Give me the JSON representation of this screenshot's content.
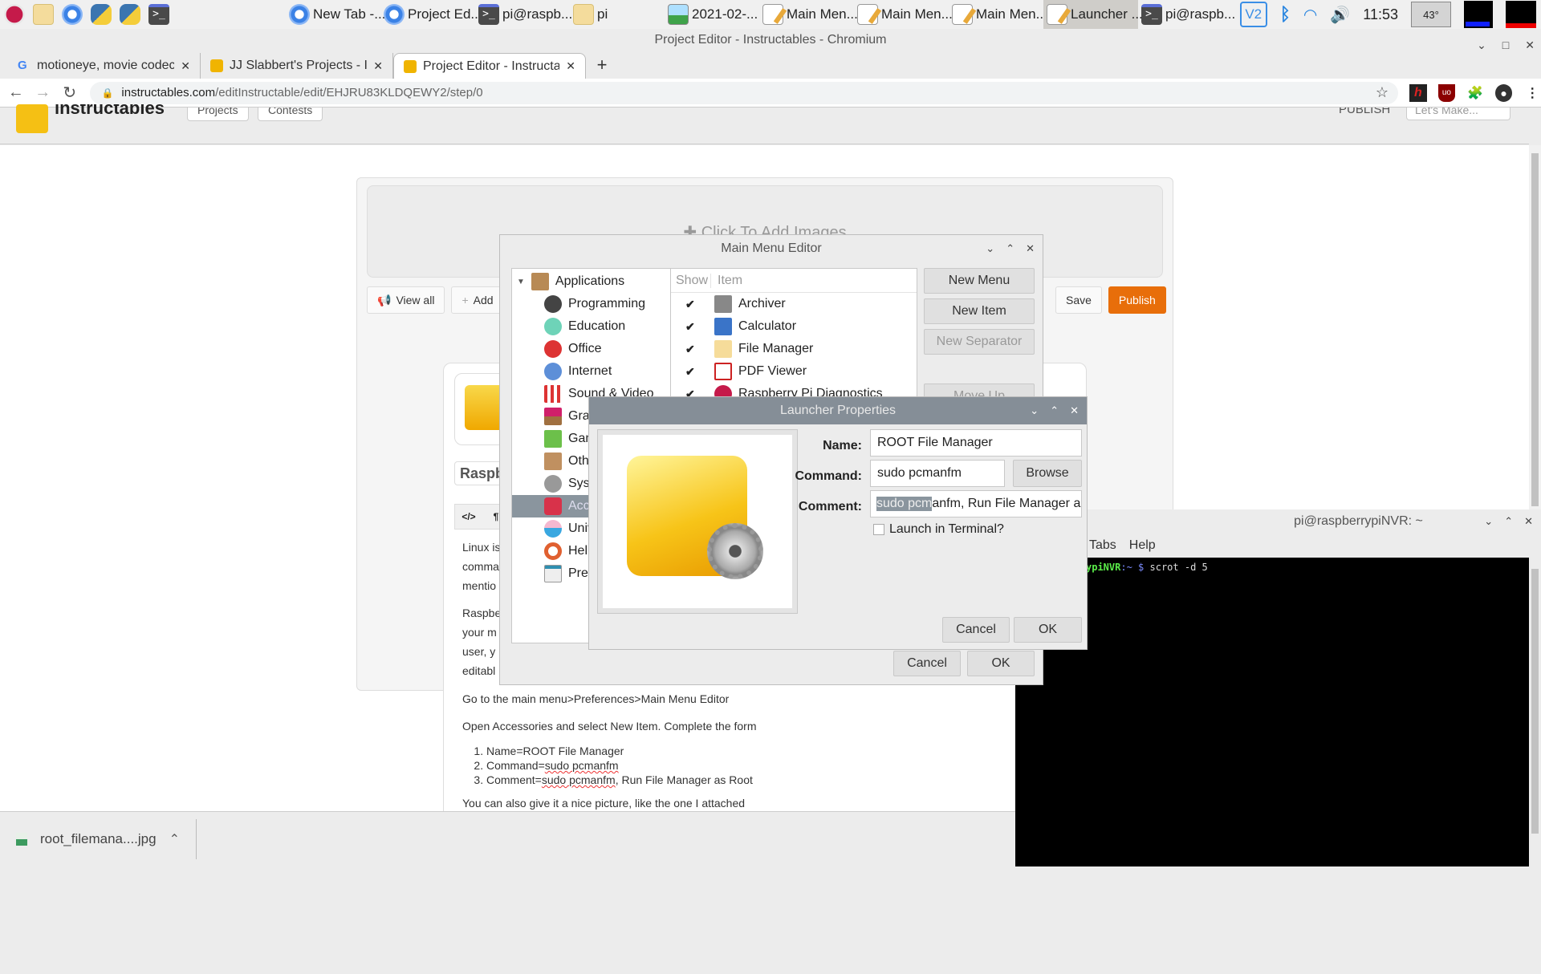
{
  "taskbar": {
    "launchers": [
      "raspberry-menu",
      "file-manager",
      "chromium",
      "python",
      "python",
      "terminal"
    ],
    "tasks": [
      {
        "label": "New Tab -...",
        "icon": "chromium"
      },
      {
        "label": "Project Ed...",
        "icon": "chromium"
      },
      {
        "label": "pi@raspb...",
        "icon": "terminal"
      },
      {
        "label": "pi",
        "icon": "folder"
      },
      {
        "label": "2021-02-...",
        "icon": "image"
      },
      {
        "label": "Main Men...",
        "icon": "menu-editor"
      },
      {
        "label": "Main Men...",
        "icon": "menu-editor"
      },
      {
        "label": "Main Men...",
        "icon": "menu-editor"
      },
      {
        "label": "Launcher ...",
        "icon": "menu-editor",
        "active": true
      },
      {
        "label": "pi@raspb...",
        "icon": "terminal"
      }
    ],
    "clock": "11:53",
    "temperature": "43°"
  },
  "browser": {
    "window_title": "Project Editor - Instructables - Chromium",
    "tabs": [
      {
        "title": "motioneye, movie codec",
        "favicon": "google"
      },
      {
        "title": "JJ Slabbert's Projects - I",
        "favicon": "instructables"
      },
      {
        "title": "Project Editor - Instructab",
        "favicon": "instructables",
        "active": true
      }
    ],
    "new_tab": "+",
    "url_host": "instructables.com",
    "url_path": "/editInstructable/edit/EHJRU83KLDQEWY2/step/0"
  },
  "site": {
    "logo": "instructables",
    "nav": [
      "Projects",
      "Contests"
    ],
    "publish_link": "PUBLISH",
    "search_placeholder": "Let's Make..."
  },
  "editor": {
    "add_images": "Click To Add Images",
    "toolbar": {
      "view_all": "View all",
      "add": "Add",
      "save": "Save",
      "publish": "Publish"
    },
    "step_title_partial": "Raspb",
    "format_buttons": [
      "</>",
      "¶"
    ],
    "paragraphs_partial": [
      "Linux is",
      "comma",
      "mentio",
      "Raspbe",
      "your m",
      "user, y",
      "editabl"
    ],
    "paragraph1": "Go to the main menu>Preferences>Main Menu Editor",
    "paragraph2": "Open Accessories and select New Item. Complete the form",
    "list": [
      {
        "prefix": "Name=ROOT File Manager",
        "sq": "",
        "rest": ""
      },
      {
        "prefix": "Command=",
        "sq": "sudo pcmanfm",
        "rest": ""
      },
      {
        "prefix": "Comment=",
        "sq": "sudo pcmanfm",
        "rest": ", Run File Manager as Root"
      }
    ],
    "paragraph3": "You can also give it a nice picture, like the one I attached"
  },
  "downloads": {
    "file": "root_filemana....jpg"
  },
  "main_menu_editor": {
    "title": "Main Menu Editor",
    "tree": [
      {
        "label": "Applications",
        "icon": "box",
        "root": true
      },
      {
        "label": "Programming",
        "icon": "programming"
      },
      {
        "label": "Education",
        "icon": "education"
      },
      {
        "label": "Office",
        "icon": "office"
      },
      {
        "label": "Internet",
        "icon": "internet"
      },
      {
        "label": "Sound & Video",
        "icon": "sound-video"
      },
      {
        "label": "Grap",
        "icon": "graphics"
      },
      {
        "label": "Gam",
        "icon": "games"
      },
      {
        "label": "Othe",
        "icon": "other"
      },
      {
        "label": "Syst",
        "icon": "system"
      },
      {
        "label": "Acce",
        "icon": "accessories",
        "selected": true
      },
      {
        "label": "Univ",
        "icon": "universal-access"
      },
      {
        "label": "Help",
        "icon": "help"
      },
      {
        "label": "Prefe",
        "icon": "preferences"
      }
    ],
    "columns": {
      "show": "Show",
      "item": "Item"
    },
    "items": [
      {
        "label": "Archiver",
        "checked": true
      },
      {
        "label": "Calculator",
        "checked": true
      },
      {
        "label": "File Manager",
        "checked": true
      },
      {
        "label": "PDF Viewer",
        "checked": true
      },
      {
        "label": "Raspberry Pi Diagnostics",
        "checked": true
      }
    ],
    "buttons": {
      "new_menu": "New Menu",
      "new_item": "New Item",
      "new_separator": "New Separator",
      "move_up": "Move Up",
      "cancel": "Cancel",
      "ok": "OK"
    }
  },
  "launcher_properties": {
    "title": "Launcher Properties",
    "name_label": "Name:",
    "name_value": "ROOT File Manager",
    "command_label": "Command:",
    "command_value": "sudo pcmanfm",
    "browse": "Browse",
    "comment_label": "Comment:",
    "comment_selected": "sudo pcm",
    "comment_rest": "anfm, Run File Manager a",
    "launch_in_terminal": "Launch in Terminal?",
    "launch_checked": false,
    "cancel": "Cancel",
    "ok": "OK"
  },
  "terminal": {
    "title": "pi@raspberrypiNVR: ~",
    "menu": [
      "Tabs",
      "Help"
    ],
    "prompt_host": "ypiNVR",
    "prompt_path": ":~ ",
    "prompt_symbol": "$",
    "command": " scrot -d 5"
  }
}
